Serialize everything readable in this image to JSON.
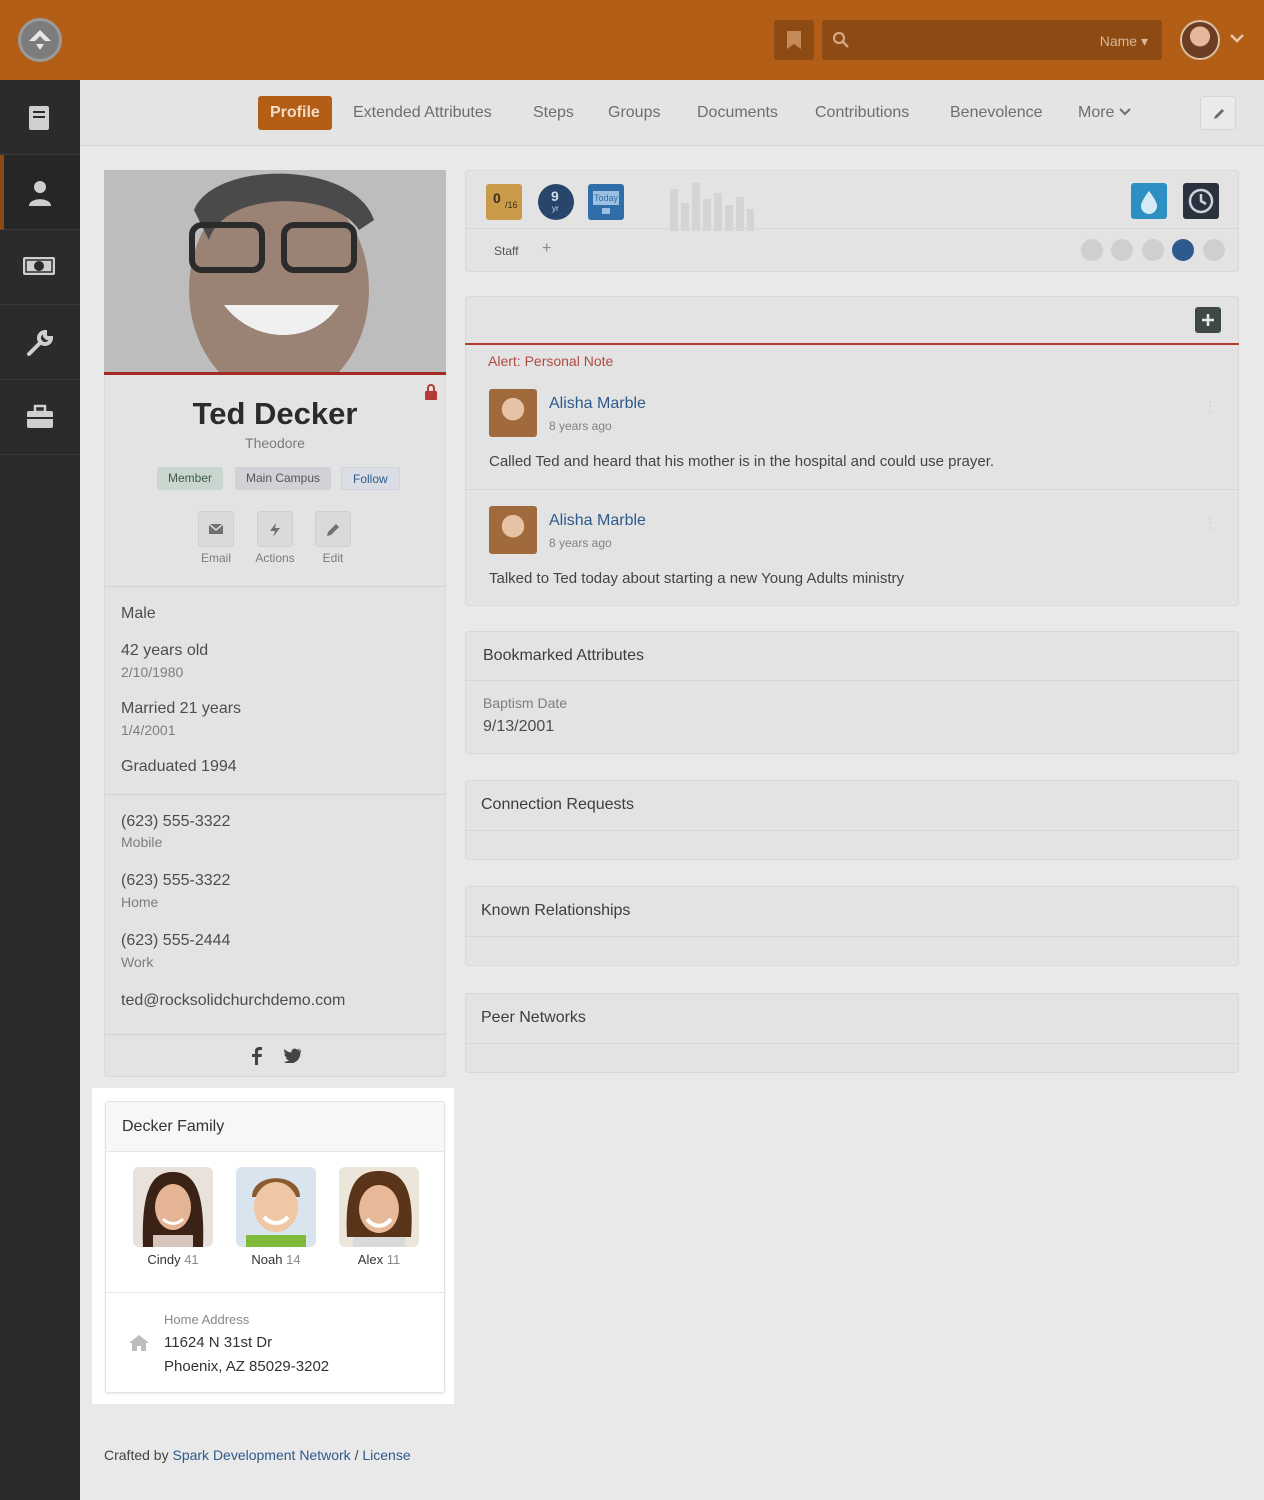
{
  "topbar": {
    "search_selector": "Name",
    "icons": {
      "logo": "rock-logo",
      "bookmark": "bookmark-icon",
      "search": "search-icon",
      "chevron": "chevron-down-icon"
    }
  },
  "sidebar": {
    "items": [
      {
        "name": "notes",
        "icon": "book-icon"
      },
      {
        "name": "people",
        "icon": "person-icon"
      },
      {
        "name": "finance",
        "icon": "money-icon"
      },
      {
        "name": "admin-tools",
        "icon": "wrench-icon"
      },
      {
        "name": "check-in",
        "icon": "briefcase-icon"
      }
    ]
  },
  "tabs": [
    "Profile",
    "Extended Attributes",
    "Steps",
    "Groups",
    "Documents",
    "Contributions",
    "Benevolence",
    "More"
  ],
  "person": {
    "name": "Ted Decker",
    "nick": "Theodore",
    "badges": {
      "member": "Member",
      "campus": "Main Campus",
      "follow": "Follow"
    },
    "actions": {
      "email": "Email",
      "actions": "Actions",
      "edit": "Edit"
    },
    "gender": "Male",
    "age": "42 years old",
    "birthdate": "2/10/1980",
    "married": "Married 21 years",
    "anniversary": "1/4/2001",
    "graduated": "Graduated 1994",
    "phones": [
      {
        "number": "(623) 555-3322",
        "type": "Mobile"
      },
      {
        "number": "(623) 555-3322",
        "type": "Home"
      },
      {
        "number": "(623) 555-2444",
        "type": "Work"
      }
    ],
    "email": "ted@rocksolidchurchdemo.com"
  },
  "badge_bar": {
    "attendance": {
      "count": "0",
      "of": "/16"
    },
    "years": {
      "count": "9",
      "unit": "yr"
    },
    "today": "Today",
    "staff_tab": "Staff",
    "add_tab": "+"
  },
  "notes": {
    "alert_label": "Alert: Personal Note",
    "items": [
      {
        "author": "Alisha Marble",
        "time": "8 years ago",
        "text": "Called Ted and heard that his mother is in the hospital and could use prayer."
      },
      {
        "author": "Alisha Marble",
        "time": "8 years ago",
        "text": "Talked to Ted today about starting a new Young Adults ministry"
      }
    ]
  },
  "bookmarked": {
    "title": "Bookmarked Attributes",
    "label": "Baptism Date",
    "value": "9/13/2001"
  },
  "connection_requests": {
    "title": "Connection Requests"
  },
  "known_relationships": {
    "title": "Known Relationships"
  },
  "peer_networks": {
    "title": "Peer Networks"
  },
  "family": {
    "title": "Decker Family",
    "members": [
      {
        "name": "Cindy",
        "age": "41"
      },
      {
        "name": "Noah",
        "age": "14"
      },
      {
        "name": "Alex",
        "age": "11"
      }
    ],
    "address_label": "Home Address",
    "address_line1": "11624 N 31st Dr",
    "address_line2": "Phoenix, AZ 85029-3202"
  },
  "footer": {
    "prefix": "Crafted by",
    "link1": "Spark Development Network",
    "sep": "/",
    "link2": "License"
  },
  "colors": {
    "brand": "#b25e16",
    "sidebar": "#2b2b2b",
    "link": "#2d5a8b",
    "alert": "#b13b33"
  }
}
